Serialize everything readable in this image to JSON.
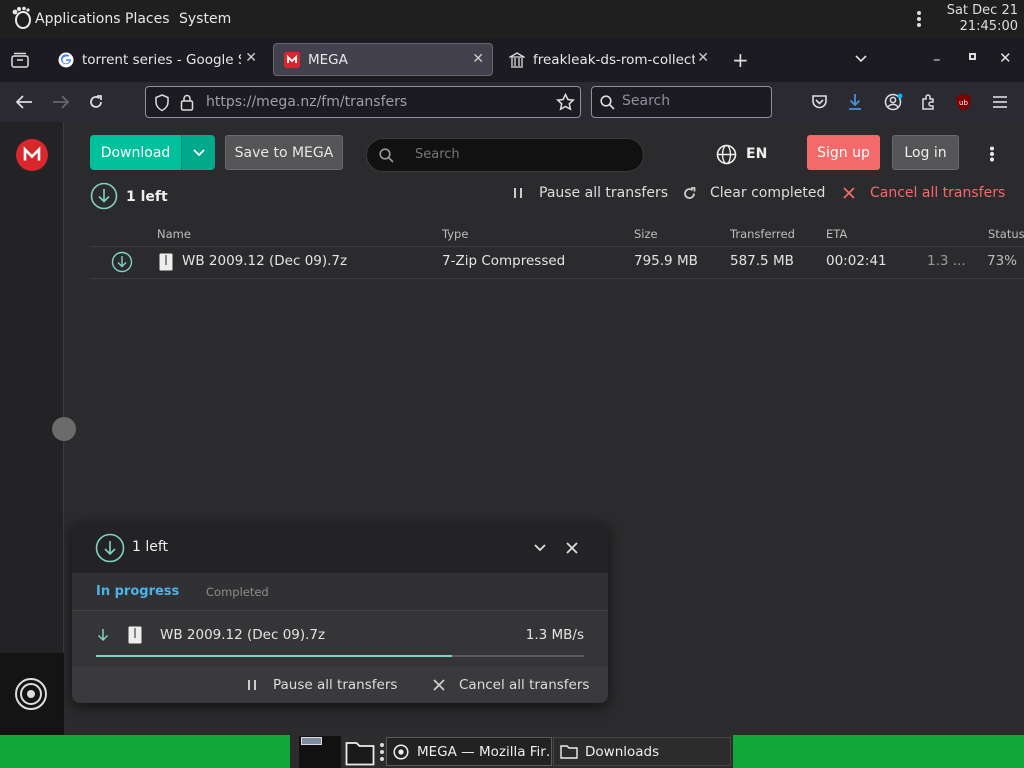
{
  "panel": {
    "applications": "Applications",
    "places": "Places",
    "system": "System",
    "date": "Sat Dec 21",
    "time": "21:45:00"
  },
  "tabs": [
    {
      "label": "torrent series - Google Search",
      "icon": "google-icon"
    },
    {
      "label": "MEGA",
      "icon": "mega-icon"
    },
    {
      "label": "freakleak-ds-rom-collection",
      "icon": "archive-icon"
    }
  ],
  "navbar": {
    "url_host": "https://mega.nz",
    "url_path": "/fm/transfers",
    "search_placeholder": "Search"
  },
  "mega": {
    "download_label": "Download",
    "save_label": "Save to MEGA",
    "search_placeholder": "Search",
    "language": "EN",
    "signup_label": "Sign up",
    "login_label": "Log in",
    "left_count": "1 left",
    "pause_all": "Pause all transfers",
    "clear_completed": "Clear completed",
    "cancel_all": "Cancel all transfers",
    "columns": {
      "name": "Name",
      "type": "Type",
      "size": "Size",
      "transferred": "Transferred",
      "eta": "ETA",
      "status": "Status"
    },
    "row": {
      "name": "WB 2009.12 (Dec 09).7z",
      "type": "7-Zip Compressed",
      "size": "795.9 MB",
      "transferred": "587.5 MB",
      "eta": "00:02:41",
      "speed": "1.3 ...",
      "status": "73%"
    },
    "accent": "#00c19b",
    "danger": "#f46a6a"
  },
  "widget": {
    "left_count": "1 left",
    "tab_progress": "In progress",
    "tab_completed": "Completed",
    "file_name": "WB 2009.12 (Dec 09).7z",
    "speed": "1.3 MB/s",
    "progress": 0.73,
    "pause_all": "Pause all transfers",
    "cancel_all": "Cancel all transfers"
  },
  "taskbar": {
    "firefox_window": "MEGA — Mozilla Fir…",
    "downloads_window": "Downloads"
  }
}
